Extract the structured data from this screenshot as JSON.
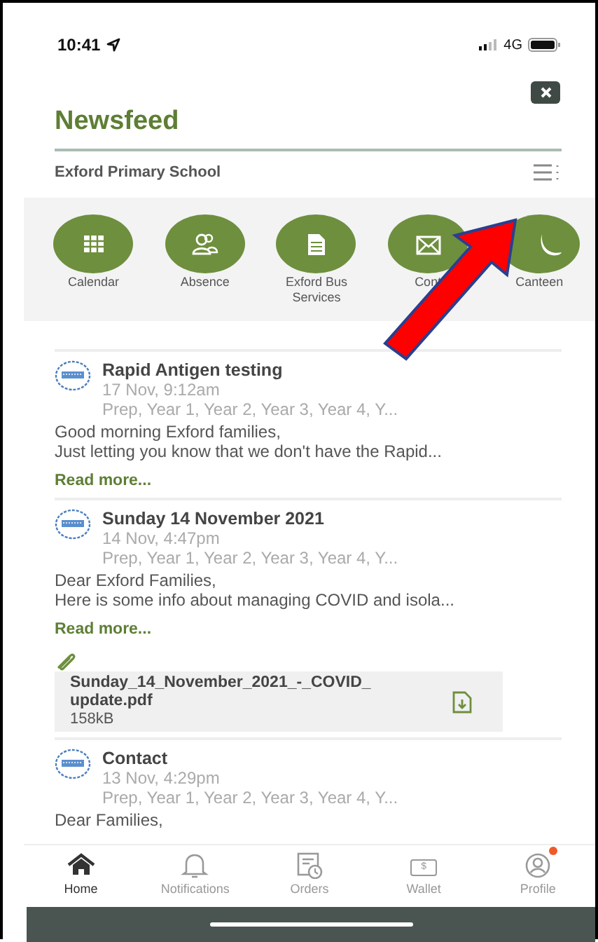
{
  "status_bar": {
    "time": "10:41",
    "network": "4G"
  },
  "header": {
    "title": "Newsfeed",
    "school": "Exford Primary School"
  },
  "shortcuts": [
    {
      "label": "Calendar"
    },
    {
      "label": "Absence"
    },
    {
      "label": "Exford Bus Services"
    },
    {
      "label": "Cont"
    },
    {
      "label": "Canteen"
    }
  ],
  "posts": [
    {
      "title": "Rapid Antigen testing",
      "date": "17 Nov, 9:12am",
      "audience": "Prep, Year 1, Year 2, Year 3, Year 4, Y...",
      "body": [
        "Good morning Exford families,",
        "Just letting you know that we don't have the Rapid..."
      ],
      "read_more": "Read more..."
    },
    {
      "title": "Sunday 14 November 2021",
      "date": "14 Nov, 4:47pm",
      "audience": "Prep, Year 1, Year 2, Year 3, Year 4, Y...",
      "body": [
        "Dear Exford Families,",
        "Here is some info about managing COVID and isola..."
      ],
      "read_more": "Read more...",
      "attachment": {
        "name": "Sunday_14_November_2021_-_COVID_update.pdf",
        "size": "158kB"
      }
    },
    {
      "title": "Contact",
      "date": "13 Nov, 4:29pm",
      "audience": "Prep, Year 1, Year 2, Year 3, Year 4, Y...",
      "body": [
        "Dear Families,"
      ]
    }
  ],
  "nav": [
    {
      "label": "Home",
      "selected": true,
      "badge": false
    },
    {
      "label": "Notifications",
      "selected": false,
      "badge": false
    },
    {
      "label": "Orders",
      "selected": false,
      "badge": false
    },
    {
      "label": "Wallet",
      "icon_text": "$",
      "selected": false,
      "badge": false
    },
    {
      "label": "Profile",
      "selected": false,
      "badge": true
    }
  ]
}
